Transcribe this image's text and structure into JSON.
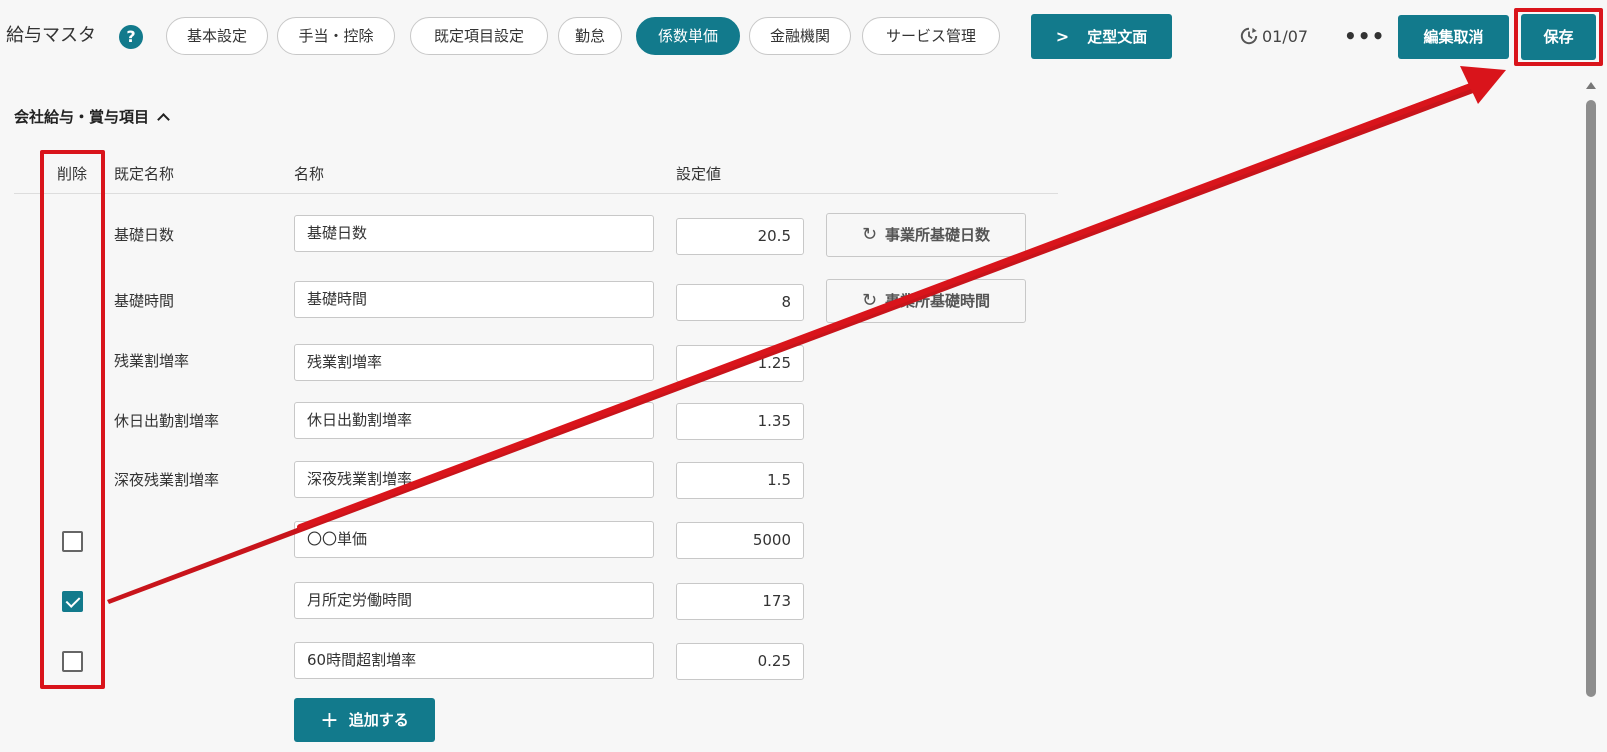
{
  "header": {
    "title": "給与マスタ",
    "help_icon": "?",
    "tabs": [
      {
        "label": "基本設定",
        "active": false
      },
      {
        "label": "手当・控除",
        "active": false
      },
      {
        "label": "既定項目設定",
        "active": false
      },
      {
        "label": "勤怠",
        "active": false
      },
      {
        "label": "係数単価",
        "active": true
      },
      {
        "label": "金融機関",
        "active": false
      },
      {
        "label": "サービス管理",
        "active": false
      }
    ],
    "template_button": {
      "chevron": ">",
      "label": "定型文面"
    },
    "history": "01/07",
    "more": "•••",
    "cancel_button": "編集取消",
    "save_button": "保存"
  },
  "section": {
    "title": "会社給与・賞与項目",
    "columns": {
      "delete": "削除",
      "default_name": "既定名称",
      "name": "名称",
      "value": "設定値"
    },
    "rows": [
      {
        "default_name": "基礎日数",
        "name": "基礎日数",
        "value": "20.5",
        "reset_label": "事業所基礎日数"
      },
      {
        "default_name": "基礎時間",
        "name": "基礎時間",
        "value": "8",
        "reset_label": "事業所基礎時間"
      },
      {
        "default_name": "残業割増率",
        "name": "残業割増率",
        "value": "1.25"
      },
      {
        "default_name": "休日出勤割増率",
        "name": "休日出勤割増率",
        "value": "1.35"
      },
      {
        "default_name": "深夜残業割増率",
        "name": "深夜残業割増率",
        "value": "1.5"
      },
      {
        "name": "〇〇単価",
        "value": "5000",
        "checked": false
      },
      {
        "name": "月所定労働時間",
        "value": "173",
        "checked": true
      },
      {
        "name": "60時間超割増率",
        "value": "0.25",
        "checked": false
      }
    ],
    "add_button": {
      "plus": "+",
      "label": "追加する"
    }
  },
  "colors": {
    "accent": "#127a8c",
    "highlight": "#d9141b"
  },
  "icons": {
    "refresh": "↻",
    "history": "clock-history-icon"
  }
}
